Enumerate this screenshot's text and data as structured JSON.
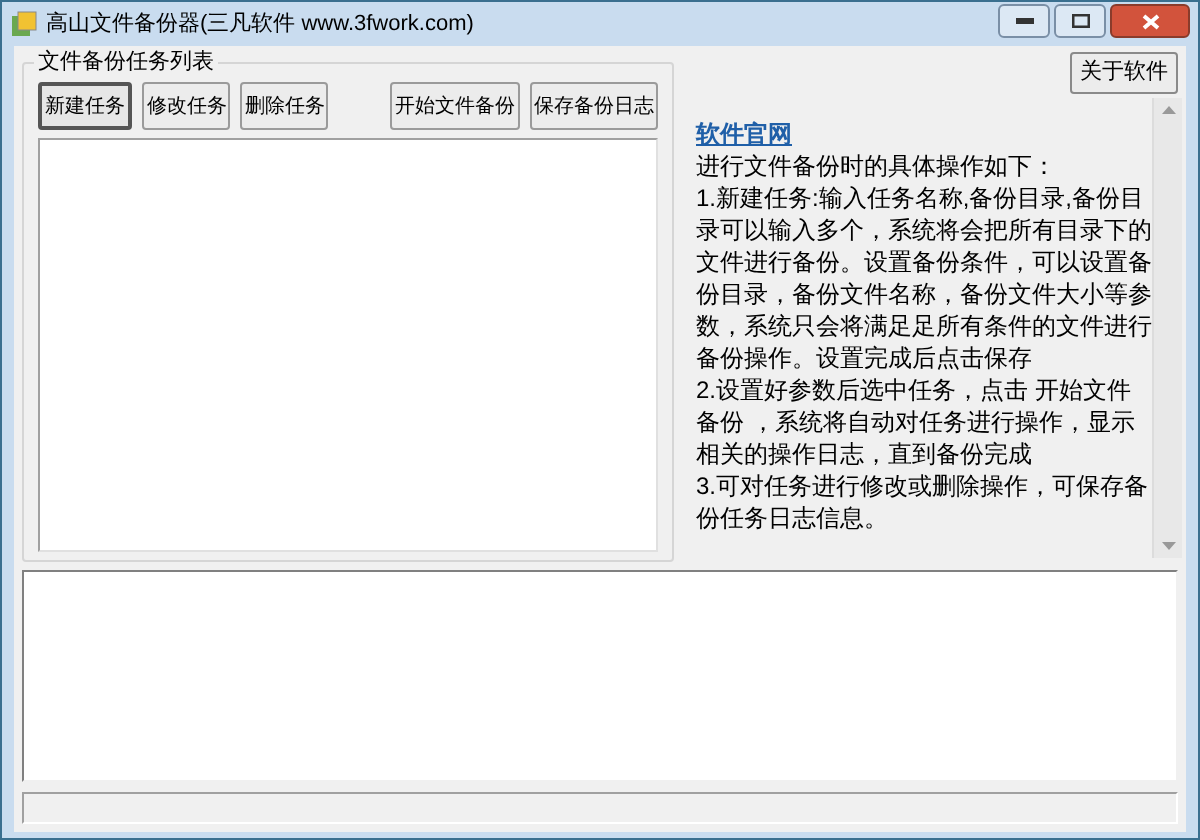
{
  "window": {
    "title": "高山文件备份器(三凡软件 www.3fwork.com)"
  },
  "task_group": {
    "label": "文件备份任务列表",
    "buttons": [
      {
        "label": "新建任务",
        "focused": true
      },
      {
        "label": "修改任务",
        "focused": false
      },
      {
        "label": "删除任务",
        "focused": false
      },
      {
        "label": "开始文件备份",
        "focused": false
      },
      {
        "label": "保存备份日志",
        "focused": false
      }
    ]
  },
  "about_button": "关于软件",
  "info": {
    "link": "软件官网",
    "intro": "进行文件备份时的具体操作如下：",
    "steps": [
      "1.新建任务:输入任务名称,备份目录,备份目录可以输入多个，系统将会把所有目录下的文件进行备份。设置备份条件，可以设置备份目录，备份文件名称，备份文件大小等参数，系统只会将满足足所有条件的文件进行备份操作。设置完成后点击保存",
      "2.设置好参数后选中任务，点击 开始文件备份 ，系统将自动对任务进行操作，显示相关的操作日志，直到备份完成",
      "3.可对任务进行修改或删除操作，可保存备份任务日志信息。"
    ]
  }
}
